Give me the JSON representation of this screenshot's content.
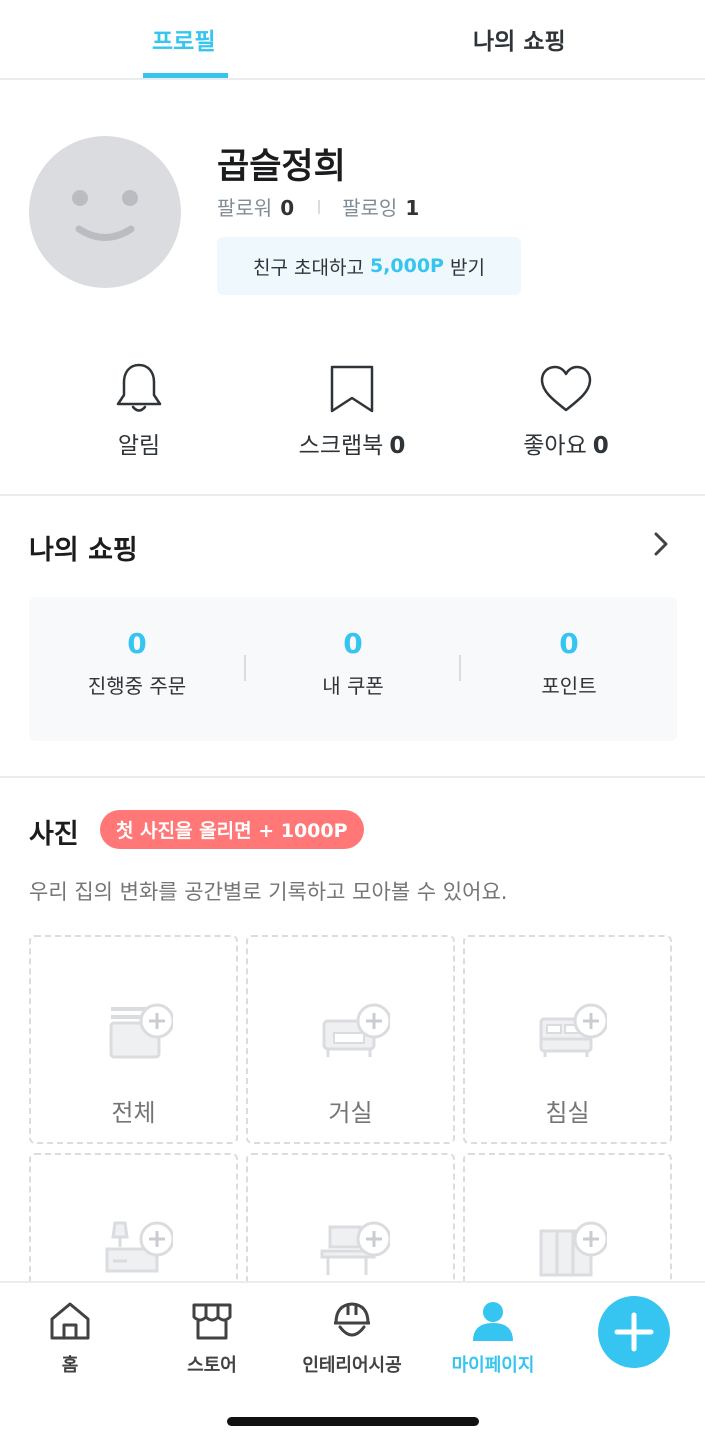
{
  "tabs": {
    "profile": "프로필",
    "shopping": "나의 쇼핑"
  },
  "profile": {
    "username": "곱슬정희",
    "followers_label": "팔로워",
    "followers_count": "0",
    "following_label": "팔로잉",
    "following_count": "1",
    "invite": {
      "prefix": "친구 초대하고",
      "highlight": "5,000P",
      "suffix": "받기"
    }
  },
  "actions": {
    "alarm": {
      "label": "알림"
    },
    "scrapbook": {
      "label": "스크랩북",
      "count": "0"
    },
    "likes": {
      "label": "좋아요",
      "count": "0"
    }
  },
  "shopping": {
    "title": "나의 쇼핑",
    "stats": [
      {
        "value": "0",
        "label": "진행중 주문"
      },
      {
        "value": "0",
        "label": "내 쿠폰"
      },
      {
        "value": "0",
        "label": "포인트"
      }
    ]
  },
  "photos": {
    "title": "사진",
    "badge": "첫 사진을 올리면 + 1000P",
    "description": "우리 집의 변화를 공간별로 기록하고 모아볼 수 있어요.",
    "rooms": [
      {
        "label": "전체",
        "icon": "all-rooms-icon"
      },
      {
        "label": "거실",
        "icon": "sofa-icon"
      },
      {
        "label": "침실",
        "icon": "bed-icon"
      },
      {
        "label": "",
        "icon": "vanity-icon"
      },
      {
        "label": "",
        "icon": "desk-icon"
      },
      {
        "label": "",
        "icon": "wardrobe-icon"
      }
    ]
  },
  "nav": {
    "items": [
      {
        "label": "홈",
        "icon": "home-icon"
      },
      {
        "label": "스토어",
        "icon": "store-icon"
      },
      {
        "label": "인테리어시공",
        "icon": "helmet-icon"
      },
      {
        "label": "마이페이지",
        "icon": "person-icon"
      }
    ],
    "fab_icon": "plus-icon"
  },
  "colors": {
    "accent": "#35c5f0",
    "badge": "#ff7777",
    "text": "#2f3438",
    "muted": "#828c94"
  }
}
